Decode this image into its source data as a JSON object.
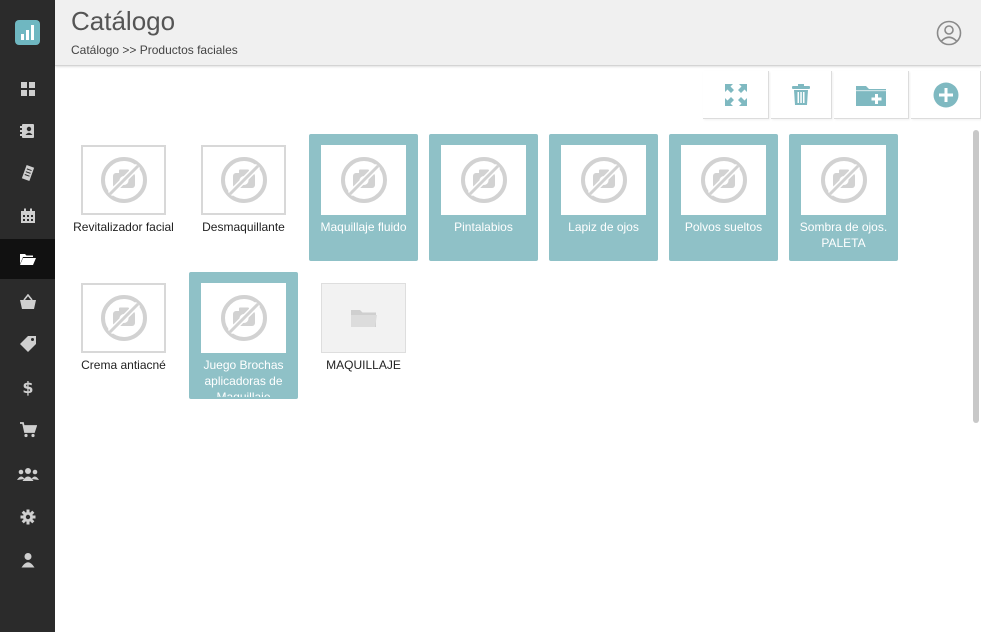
{
  "header": {
    "title": "Catálogo",
    "breadcrumb": "Catálogo >> Productos faciales"
  },
  "sidebar": {
    "logo_icon": "bar-chart-icon",
    "items": [
      {
        "id": "dashboard",
        "icon": "grid-icon"
      },
      {
        "id": "contacts",
        "icon": "address-book-icon"
      },
      {
        "id": "tickets",
        "icon": "receipt-icon"
      },
      {
        "id": "calendar",
        "icon": "calendar-icon"
      },
      {
        "id": "catalog",
        "icon": "folder-open-icon",
        "active": true
      },
      {
        "id": "shop",
        "icon": "basket-icon"
      },
      {
        "id": "tags",
        "icon": "tag-icon"
      },
      {
        "id": "payments",
        "icon": "dollar-icon"
      },
      {
        "id": "cart",
        "icon": "cart-icon"
      },
      {
        "id": "users",
        "icon": "users-icon"
      },
      {
        "id": "settings",
        "icon": "gear-icon"
      },
      {
        "id": "profile",
        "icon": "user-icon"
      }
    ]
  },
  "toolbar": {
    "buttons": [
      {
        "id": "expand",
        "icon": "expand-icon"
      },
      {
        "id": "delete",
        "icon": "trash-icon"
      },
      {
        "id": "new-folder",
        "icon": "folder-plus-icon"
      },
      {
        "id": "add",
        "icon": "plus-circle-icon"
      }
    ]
  },
  "tiles": [
    {
      "label": "Revitalizador facial",
      "selected": false,
      "kind": "product"
    },
    {
      "label": "Desmaquillante",
      "selected": false,
      "kind": "product"
    },
    {
      "label": "Maquillaje fluido",
      "selected": true,
      "kind": "product"
    },
    {
      "label": "Pintalabios",
      "selected": true,
      "kind": "product"
    },
    {
      "label": "Lapiz de ojos",
      "selected": true,
      "kind": "product"
    },
    {
      "label": "Polvos sueltos",
      "selected": true,
      "kind": "product"
    },
    {
      "label": "Sombra de ojos. PALETA",
      "selected": true,
      "kind": "product"
    },
    {
      "label": "Crema antiacné",
      "selected": false,
      "kind": "product"
    },
    {
      "label": "Juego Brochas aplicadoras de Maquillaje",
      "selected": true,
      "kind": "product"
    },
    {
      "label": "MAQUILLAJE",
      "selected": false,
      "kind": "folder"
    }
  ],
  "colors": {
    "sidebar_bg": "#2b2b2b",
    "accent": "#8fc1c7",
    "toolbar_icon": "#7fb9c1",
    "header_bg": "#f0f0f0"
  }
}
